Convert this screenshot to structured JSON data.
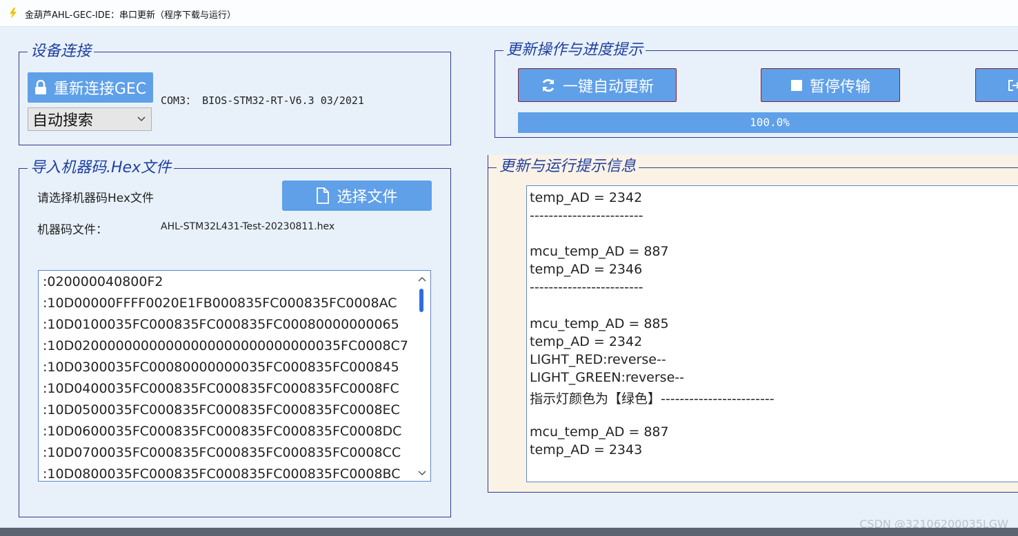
{
  "window": {
    "title": "金葫芦AHL-GEC-IDE：串口更新（程序下载与运行）",
    "icon": "lightning-icon"
  },
  "device": {
    "legend": "设备连接",
    "reconnect_label": "重新连接GEC",
    "port_info": "COM3：  BIOS-STM32-RT-V6.3 03/2021",
    "search_mode": "自动搜索"
  },
  "hex": {
    "legend": "导入机器码.Hex文件",
    "prompt": "请选择机器码Hex文件",
    "choose_label": "选择文件",
    "file_label": "机器码文件：",
    "file_name": "AHL-STM32L431-Test-20230811.hex",
    "lines": [
      ":020000040800F2",
      ":10D00000FFFF0020E1FB000835FC000835FC0008AC",
      ":10D0100035FC000835FC000835FC00080000000065",
      ":10D02000000000000000000000000000035FC0008C7",
      ":10D0300035FC00080000000035FC000835FC000845",
      ":10D0400035FC000835FC000835FC000835FC0008FC",
      ":10D0500035FC000835FC000835FC000835FC0008EC",
      ":10D0600035FC000835FC000835FC000835FC0008DC",
      ":10D0700035FC000835FC000835FC000835FC0008CC",
      ":10D0800035FC000835FC000835FC000835FC0008BC"
    ]
  },
  "update": {
    "legend": "更新操作与进度提示",
    "auto_update_label": "一键自动更新",
    "pause_label": "暂停传输",
    "progress_text": "100.0%",
    "progress_fraction": 1.0
  },
  "messages": {
    "legend": "更新与运行提示信息",
    "lines": [
      "temp_AD = 2342",
      "------------------------",
      "",
      "mcu_temp_AD = 887",
      "temp_AD = 2346",
      "------------------------",
      "",
      "mcu_temp_AD = 885",
      "temp_AD = 2342",
      " LIGHT_RED:reverse--",
      " LIGHT_GREEN:reverse--",
      "指示灯颜色为【绿色】------------------------",
      "",
      "mcu_temp_AD = 887",
      "temp_AD = 2343"
    ]
  },
  "watermark": "CSDN @32106200035LGW",
  "colors": {
    "accent": "#5fa0e8",
    "frame": "#2e3a8c",
    "legend_text": "#1f3fa0",
    "cream": "#fbf2e6"
  }
}
